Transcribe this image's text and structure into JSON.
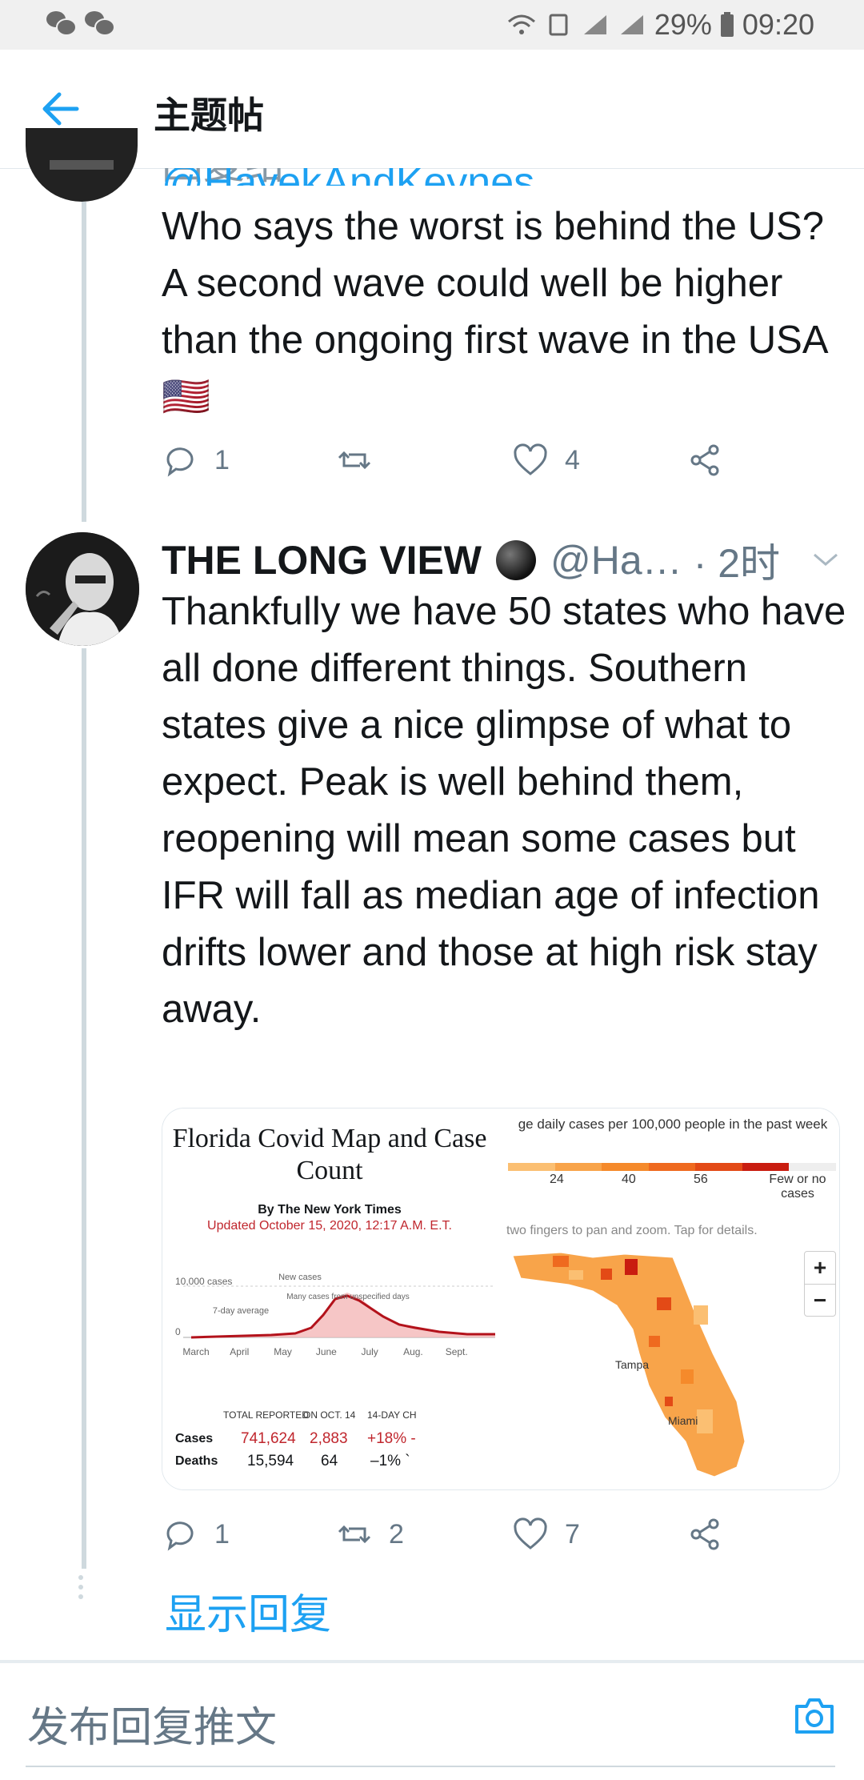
{
  "status_bar": {
    "battery": "29%",
    "time": "09:20"
  },
  "header": {
    "title": "主题帖"
  },
  "reply_tweet": {
    "reply_prefix": "回复给",
    "reply_handle": "@HayekAndKeynes",
    "text": "Who says the worst is behind the US? A second wave could well be higher than the ongoing first wave in the USA 🇺🇸",
    "reply_count": "1",
    "like_count": "4"
  },
  "main_tweet": {
    "name": "THE LONG VIEW",
    "handle": "@Ha…",
    "time": "· 2时",
    "text": "Thankfully we have 50 states who have all done different things. Southern states give a nice glimpse of what to expect. Peak is well behind them, reopening will mean some cases but IFR will fall as median age of infection drifts lower and those at high risk stay away.",
    "reply_count": "1",
    "retweet_count": "2",
    "like_count": "7"
  },
  "media": {
    "nyt": {
      "title": "Florida Covid Map and Case Count",
      "byline": "By The New York Times",
      "updated": "Updated October 15, 2020, 12:17 A.M. E.T.",
      "y_label_top": "10,000 cases",
      "y_label_zero": "0",
      "ann_new_cases": "New cases",
      "ann_avg": "7-day average",
      "ann_unspecified": "Many cases from unspecified days",
      "months": [
        "March",
        "April",
        "May",
        "June",
        "July",
        "Aug.",
        "Sept."
      ],
      "table_headers": [
        "TOTAL REPORTED",
        "ON OCT. 14",
        "14-DAY CH"
      ],
      "rows": [
        {
          "label": "Cases",
          "total": "741,624",
          "day": "2,883",
          "change": "+18% -"
        },
        {
          "label": "Deaths",
          "total": "15,594",
          "day": "64",
          "change": "–1% `"
        }
      ]
    },
    "map": {
      "legend_title": "ge daily cases per 100,000 people in the past week",
      "ticks": [
        "24",
        "40",
        "56"
      ],
      "few_label": "Few or no cases",
      "hint": "two fingers to pan and zoom. Tap for details.",
      "zoom_in": "+",
      "zoom_out": "−",
      "city_tampa": "Tampa",
      "city_miami": "Miami",
      "colors": [
        "#fbbf72",
        "#f8a44a",
        "#f58a2b",
        "#ef6a1f",
        "#e34a16",
        "#c91d10",
        "#eeeeee"
      ]
    }
  },
  "show_replies": "显示回复",
  "compose": {
    "placeholder": "发布回复推文"
  },
  "colors": {
    "accent": "#1da1f2",
    "muted": "#657786"
  }
}
